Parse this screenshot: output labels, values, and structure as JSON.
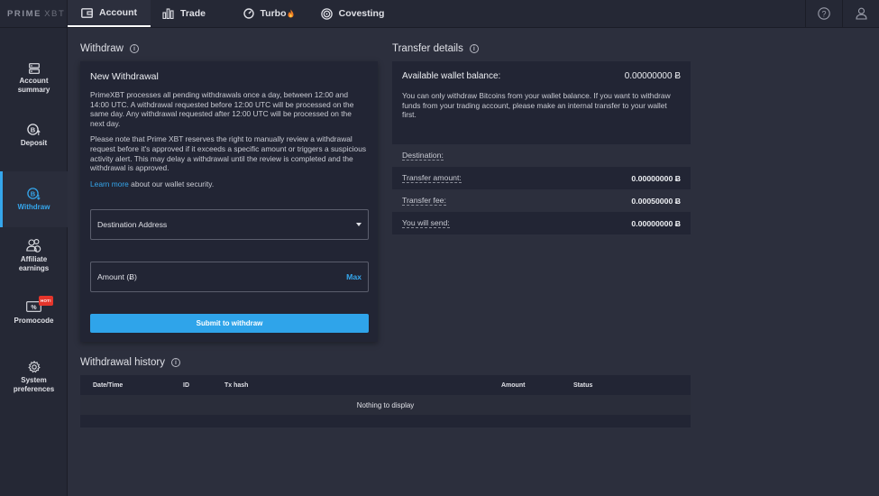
{
  "app": {
    "logo_main": "PRIME",
    "logo_sub": "XBT"
  },
  "nav": {
    "tabs": [
      {
        "label": "Account",
        "icon": "wallet-icon"
      },
      {
        "label": "Trade",
        "icon": "bar-chart-icon"
      },
      {
        "label": "Turbo",
        "icon": "turbo-gauge-icon",
        "badge": "fire-icon"
      },
      {
        "label": "Covesting",
        "icon": "covesting-icon"
      }
    ],
    "right_icons": [
      "help-icon",
      "user-icon"
    ]
  },
  "sidebar": {
    "items": [
      {
        "label": "Account\nsummary",
        "icon": "server-icon",
        "active": false
      },
      {
        "label": "Deposit",
        "icon": "bitcoin-deposit-icon",
        "active": false
      },
      {
        "label": "Withdraw",
        "icon": "bitcoin-withdraw-icon",
        "active": true
      },
      {
        "label": "Affiliate\nearnings",
        "icon": "users-icon",
        "active": false
      },
      {
        "label": "Promocode",
        "icon": "ticket-icon",
        "active": false,
        "badge": "HOT!"
      },
      {
        "label": "System\npreferences",
        "icon": "gear-icon",
        "active": false
      }
    ]
  },
  "withdraw": {
    "section_title": "Withdraw",
    "heading": "New Withdrawal",
    "para1": "PrimeXBT processes all pending withdrawals once a day, between 12:00 and 14:00 UTC. A withdrawal requested before 12:00 UTC will be processed on the same day. Any withdrawal requested after 12:00 UTC will be processed on the next day.",
    "para2": "Please note that Prime XBT reserves the right to manually review a withdrawal request before it's approved if it exceeds a specific amount or triggers a suspicious activity alert. This may delay a withdrawal until the review is completed and the withdrawal is approved.",
    "learn_more": "Learn more",
    "learn_more_rest": " about our wallet security.",
    "destination_label": "Destination Address",
    "amount_label": "Amount (Ƀ)",
    "max_label": "Max",
    "submit_label": "Submit to withdraw"
  },
  "transfer": {
    "section_title": "Transfer details",
    "balance_label": "Available wallet balance:",
    "balance_value": "0.00000000 Ƀ",
    "note": "You can only withdraw Bitcoins from your wallet balance. If you want to withdraw funds from your trading account, please make an internal transfer to your wallet first.",
    "rows": [
      {
        "label": "Destination:",
        "value": ""
      },
      {
        "label": "Transfer amount:",
        "value": "0.00000000 Ƀ"
      },
      {
        "label": "Transfer fee:",
        "value": "0.00050000 Ƀ"
      },
      {
        "label": "You will send:",
        "value": "0.00000000 Ƀ"
      }
    ]
  },
  "history": {
    "section_title": "Withdrawal history",
    "columns": [
      "Date/Time",
      "ID",
      "Tx hash",
      "Amount",
      "Status"
    ],
    "empty_text": "Nothing to display"
  },
  "colors": {
    "accent": "#2fa4ea",
    "background": "#2c2f3d",
    "panel": "#222534",
    "hot_badge": "#e5352b"
  }
}
